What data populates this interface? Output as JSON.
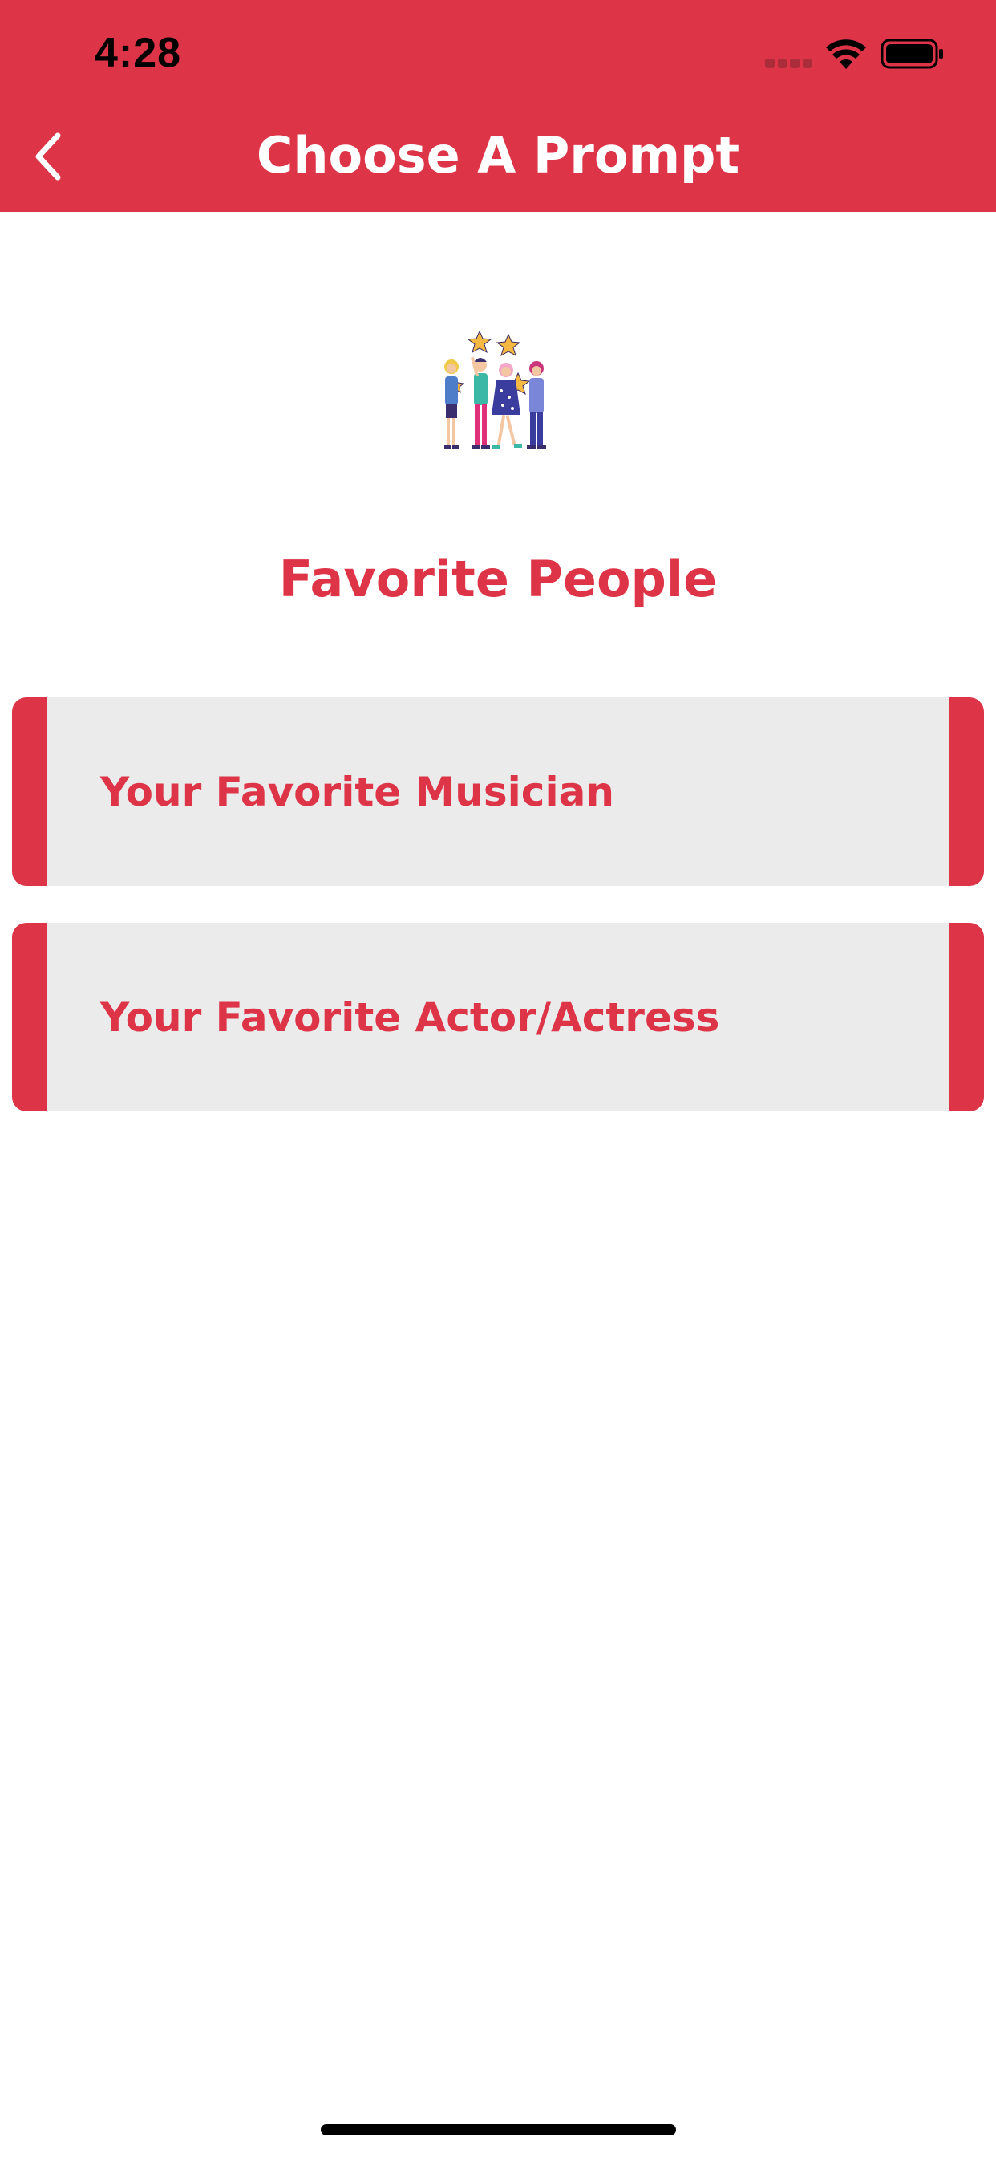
{
  "status_bar": {
    "time": "4:28"
  },
  "header": {
    "title": "Choose A Prompt",
    "back_icon": "chevron-left-icon"
  },
  "category": {
    "illustration_icon": "people-holding-stars-illustration",
    "title": "Favorite People"
  },
  "prompts": [
    {
      "label": "Your Favorite Musician"
    },
    {
      "label": "Your Favorite Actor/Actress"
    }
  ],
  "colors": {
    "accent": "#DE3447",
    "card_background": "#EBEBEB",
    "background": "#FFFFFF"
  }
}
